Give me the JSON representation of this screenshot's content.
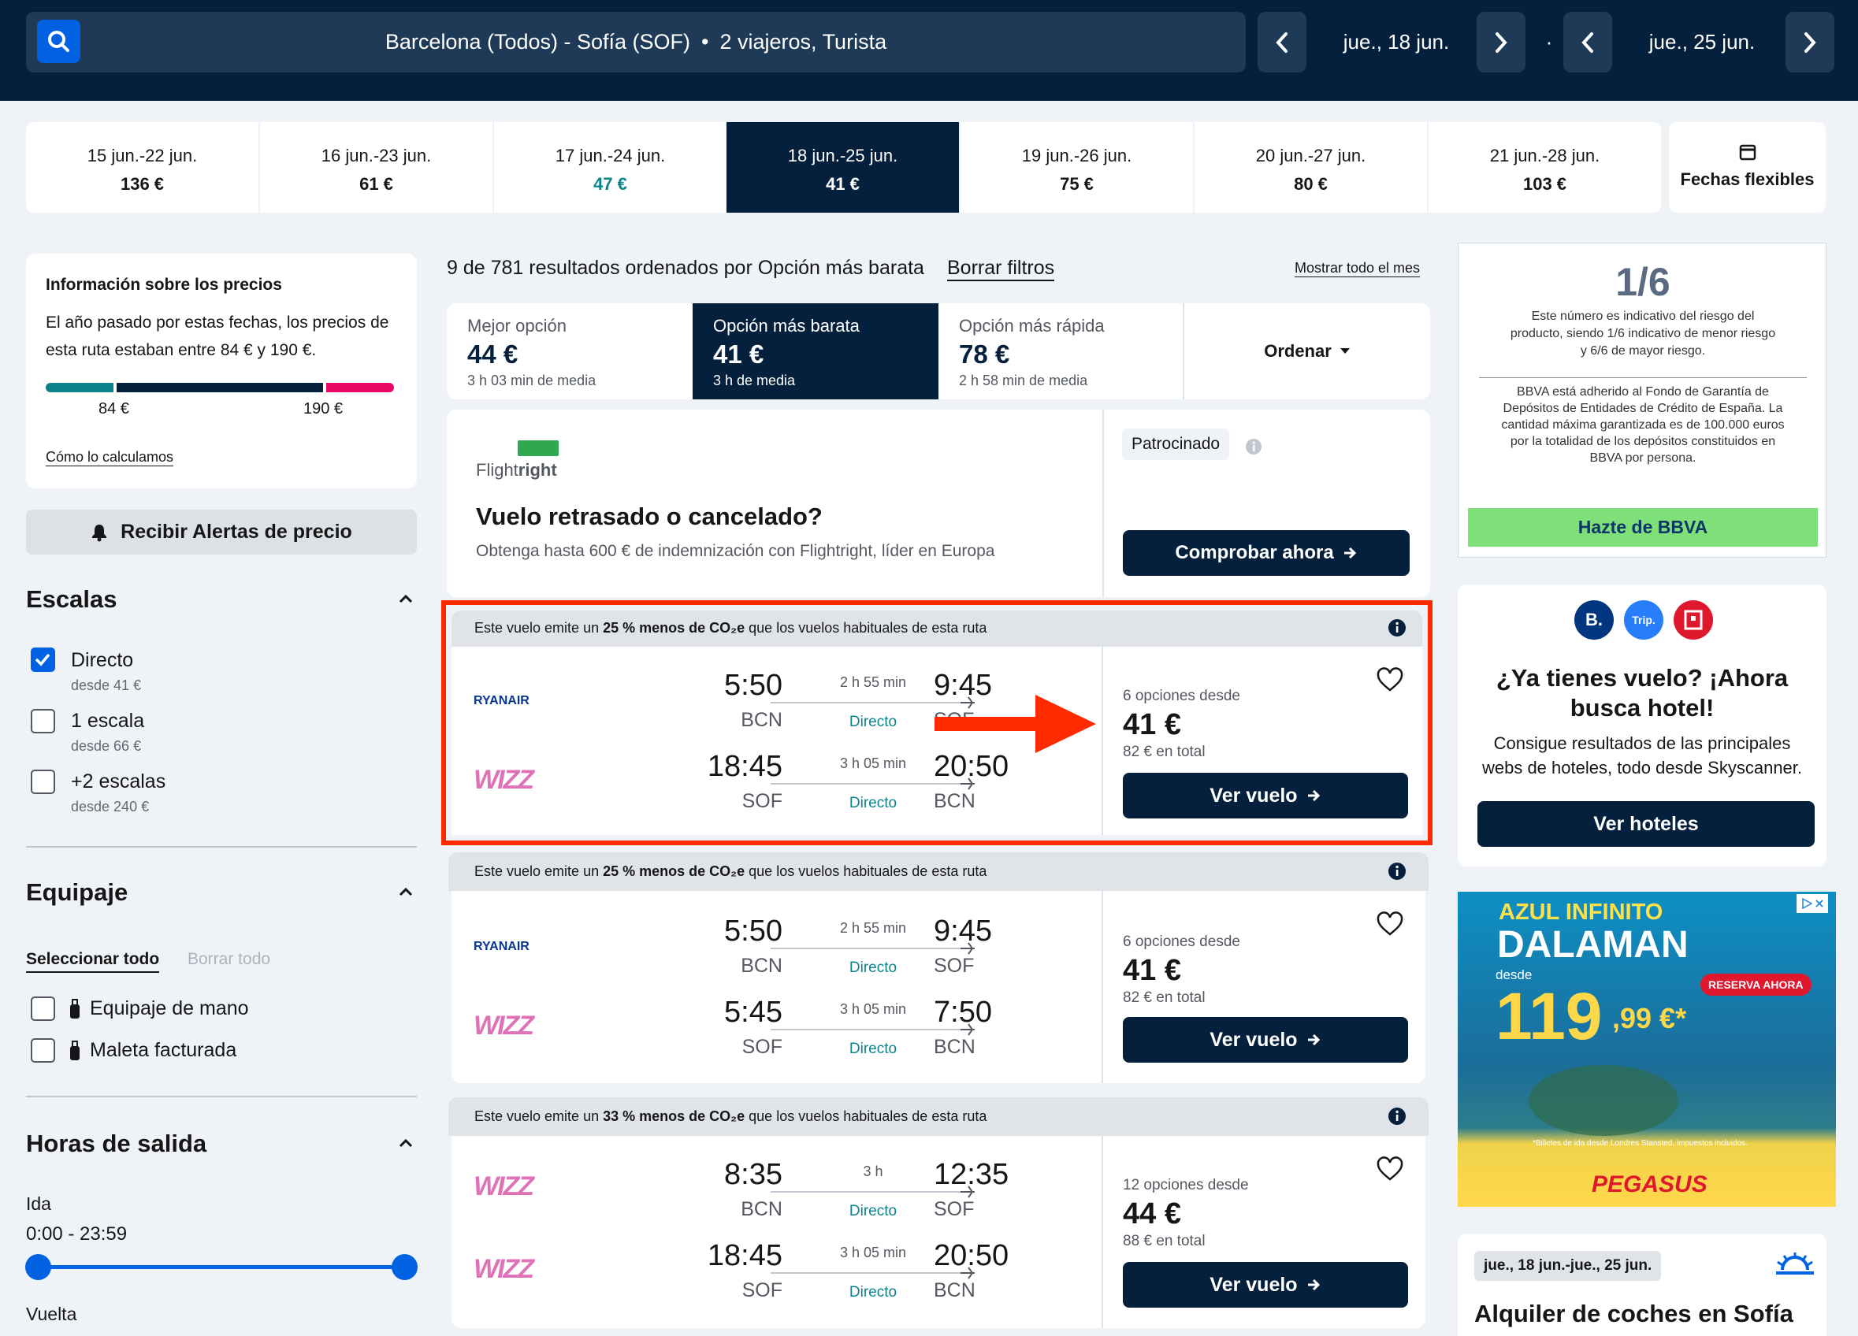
{
  "search": {
    "route": "Barcelona (Todos) - Sofía (SOF)",
    "dot": "•",
    "travellers": "2 viajeros, Turista",
    "depart_date": "jue., 18 jun.",
    "sep": "·",
    "return_date": "jue., 25 jun."
  },
  "date_strip": [
    {
      "dates": "15 jun.-22 jun.",
      "price": "136 €"
    },
    {
      "dates": "16 jun.-23 jun.",
      "price": "61 €"
    },
    {
      "dates": "17 jun.-24 jun.",
      "price": "47 €"
    },
    {
      "dates": "18 jun.-25 jun.",
      "price": "41 €"
    },
    {
      "dates": "19 jun.-26 jun.",
      "price": "75 €"
    },
    {
      "dates": "20 jun.-27 jun.",
      "price": "80 €"
    },
    {
      "dates": "21 jun.-28 jun.",
      "price": "103 €"
    }
  ],
  "flexible_label": "Fechas flexibles",
  "price_info": {
    "title": "Información sobre los precios",
    "text": "El año pasado por estas fechas, los precios de esta ruta estaban entre 84 € y 190 €.",
    "low": "84 €",
    "high": "190 €",
    "how_link": "Cómo lo calculamos"
  },
  "alerts_button": "Recibir Alertas de precio",
  "filters": {
    "stops_title": "Escalas",
    "stops": [
      {
        "label": "Directo",
        "sub": "desde 41 €",
        "checked": true
      },
      {
        "label": "1 escala",
        "sub": "desde 66 €",
        "checked": false
      },
      {
        "label": "+2 escalas",
        "sub": "desde 240 €",
        "checked": false
      }
    ],
    "baggage_title": "Equipaje",
    "select_all": "Seleccionar todo",
    "clear_all": "Borrar todo",
    "baggage": [
      {
        "label": "Equipaje de mano"
      },
      {
        "label": "Maleta facturada"
      }
    ],
    "times_title": "Horas de salida",
    "outbound": "Ida",
    "outbound_range": "0:00 - 23:59",
    "return": "Vuelta"
  },
  "results": {
    "summary": "9 de 781 resultados ordenados por Opción más barata",
    "clear_filters": "Borrar filtros",
    "show_month": "Mostrar todo el mes"
  },
  "sort": [
    {
      "title": "Mejor opción",
      "price": "44 €",
      "sub": "3 h 03 min de media"
    },
    {
      "title": "Opción más barata",
      "price": "41 €",
      "sub": "3 h de media"
    },
    {
      "title": "Opción más rápida",
      "price": "78 €",
      "sub": "2 h 58 min de media"
    }
  ],
  "order_label": "Ordenar",
  "sponsored": {
    "brand_prefix": "Flight",
    "brand_suffix": "right",
    "title": "Vuelo retrasado o cancelado?",
    "text": "Obtenga hasta 600 € de indemnización con Flightright, líder en Europa",
    "tag": "Patrocinado",
    "cta": "Comprobar ahora"
  },
  "flights": [
    {
      "eco_pre": "Este vuelo emite un ",
      "eco_pct": "25 % menos de CO₂e",
      "eco_post": " que los vuelos habituales de esta ruta",
      "legs": [
        {
          "airline": "RYANAIR",
          "dep": "5:50",
          "from": "BCN",
          "dur": "2 h 55 min",
          "stop": "Directo",
          "arr": "9:45",
          "to": "SOF"
        },
        {
          "airline": "WIZZ",
          "dep": "18:45",
          "from": "SOF",
          "dur": "3 h 05 min",
          "stop": "Directo",
          "arr": "20:50",
          "to": "BCN"
        }
      ],
      "options": "6 opciones desde",
      "price": "41 €",
      "total": "82 € en total",
      "cta": "Ver vuelo"
    },
    {
      "eco_pre": "Este vuelo emite un ",
      "eco_pct": "25 % menos de CO₂e",
      "eco_post": " que los vuelos habituales de esta ruta",
      "legs": [
        {
          "airline": "RYANAIR",
          "dep": "5:50",
          "from": "BCN",
          "dur": "2 h 55 min",
          "stop": "Directo",
          "arr": "9:45",
          "to": "SOF"
        },
        {
          "airline": "WIZZ",
          "dep": "5:45",
          "from": "SOF",
          "dur": "3 h 05 min",
          "stop": "Directo",
          "arr": "7:50",
          "to": "BCN"
        }
      ],
      "options": "6 opciones desde",
      "price": "41 €",
      "total": "82 € en total",
      "cta": "Ver vuelo"
    },
    {
      "eco_pre": "Este vuelo emite un ",
      "eco_pct": "33 % menos de CO₂e",
      "eco_post": " que los vuelos habituales de esta ruta",
      "legs": [
        {
          "airline": "WIZZ",
          "dep": "8:35",
          "from": "BCN",
          "dur": "3 h",
          "stop": "Directo",
          "arr": "12:35",
          "to": "SOF"
        },
        {
          "airline": "WIZZ",
          "dep": "18:45",
          "from": "SOF",
          "dur": "3 h 05 min",
          "stop": "Directo",
          "arr": "20:50",
          "to": "BCN"
        }
      ],
      "options": "12 opciones desde",
      "price": "44 €",
      "total": "88 € en total",
      "cta": "Ver vuelo"
    }
  ],
  "bbva": {
    "ratio": "1/6",
    "risk_text": "Este número es indicativo del riesgo del producto, siendo 1/6 indicativo de menor riesgo y 6/6 de mayor riesgo.",
    "fund_text": "BBVA está adherido al Fondo de Garantía de Depósitos de Entidades de Crédito de España. La cantidad máxima garantizada es de 100.000 euros por la totalidad de los depósitos constituidos en BBVA por persona.",
    "cta": "Hazte de BBVA"
  },
  "hotel": {
    "title": "¿Ya tienes vuelo? ¡Ahora busca hotel!",
    "text": "Consigue resultados de las principales webs de hoteles, todo desde Skyscanner.",
    "cta": "Ver hoteles",
    "logo_b": "B.",
    "logo_trip": "Trip."
  },
  "ad": {
    "line1": "AZUL INFINITO",
    "line2": "DALAMAN",
    "desde": "desde",
    "cta": "RESERVA AHORA",
    "price": "119",
    "cents": ",99 €*",
    "fine": "*Billetes de ida desde Londres Stansted, impuestos incluidos.",
    "brand": "PEGASUS"
  },
  "car": {
    "dates": "jue., 18 jun.-jue., 25 jun.",
    "title": "Alquiler de coches en Sofía"
  },
  "colors": {
    "navy": "#05203c",
    "blue": "#0062e3",
    "teal": "#0c838a",
    "pink": "#e70866",
    "red": "#ff2a00",
    "green": "#7fe07a"
  }
}
